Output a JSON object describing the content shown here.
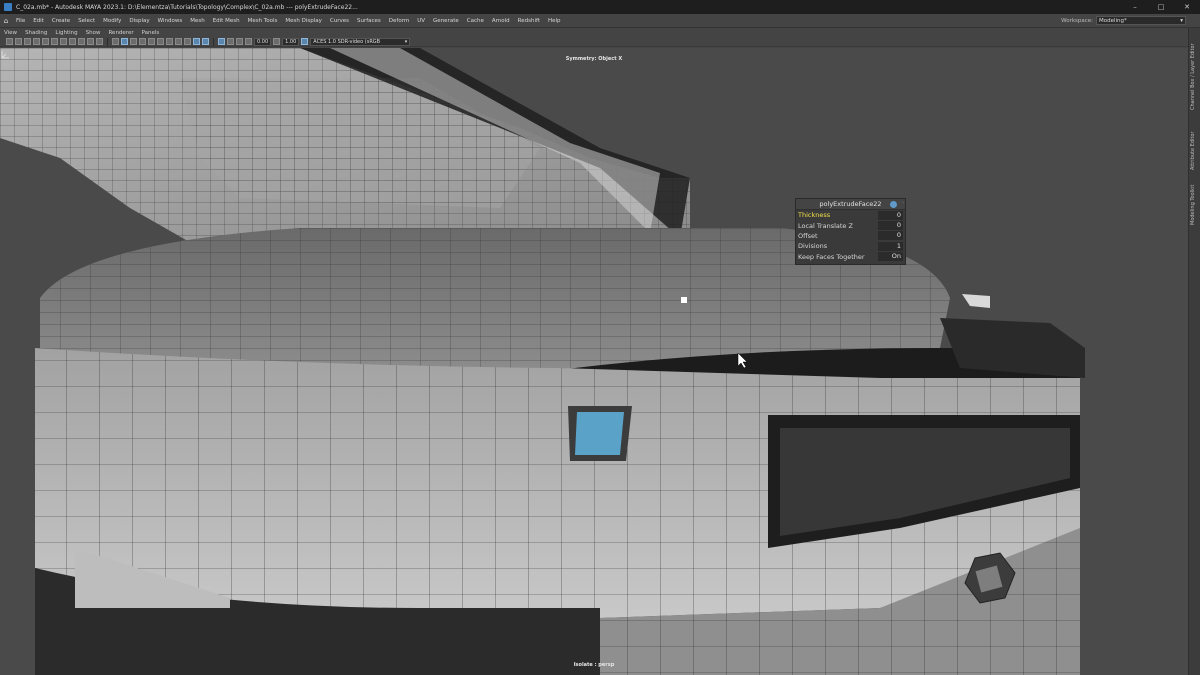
{
  "titlebar": {
    "title": "C_02a.mb* - Autodesk MAYA 2023.1: D:\\Elementza\\Tutorials\\Topology\\Complex\\C_02a.mb  ---  polyExtrudeFace22...",
    "minimize": "–",
    "maximize": "□",
    "close": "✕"
  },
  "menubar": {
    "items": [
      "File",
      "Edit",
      "Create",
      "Select",
      "Modify",
      "Display",
      "Windows",
      "Mesh",
      "Edit Mesh",
      "Mesh Tools",
      "Mesh Display",
      "Curves",
      "Surfaces",
      "Deform",
      "UV",
      "Generate",
      "Cache",
      "Arnold",
      "Redshift",
      "Help"
    ],
    "workspace_label": "Workspace:",
    "workspace_value": "Modeling*"
  },
  "panel_menu": {
    "items": [
      "View",
      "Shading",
      "Lighting",
      "Show",
      "Renderer",
      "Panels"
    ]
  },
  "toolbar": {
    "field1": "0.00",
    "field2": "1.00",
    "colorspace": "ACES 1.0 SDR-video (sRGB"
  },
  "viewport": {
    "symmetry_label": "Symmetry: Object X",
    "camera_label": "Isolate : persp"
  },
  "side_tabs": [
    "Channel Box / Layer Editor",
    "Attribute Editor",
    "Modeling Toolkit"
  ],
  "inview_editor": {
    "title": "polyExtrudeFace22",
    "attributes": [
      {
        "label": "Thickness",
        "value": "0"
      },
      {
        "label": "Local Translate Z",
        "value": "0"
      },
      {
        "label": "Offset",
        "value": "0"
      },
      {
        "label": "Divisions",
        "value": "1"
      },
      {
        "label": "Keep Faces Together",
        "value": "On"
      }
    ]
  },
  "colors": {
    "selected_face": "#5aa2c8",
    "highlight_attr": "#f2e04a",
    "viewport_bg": "#4a4a4a"
  }
}
